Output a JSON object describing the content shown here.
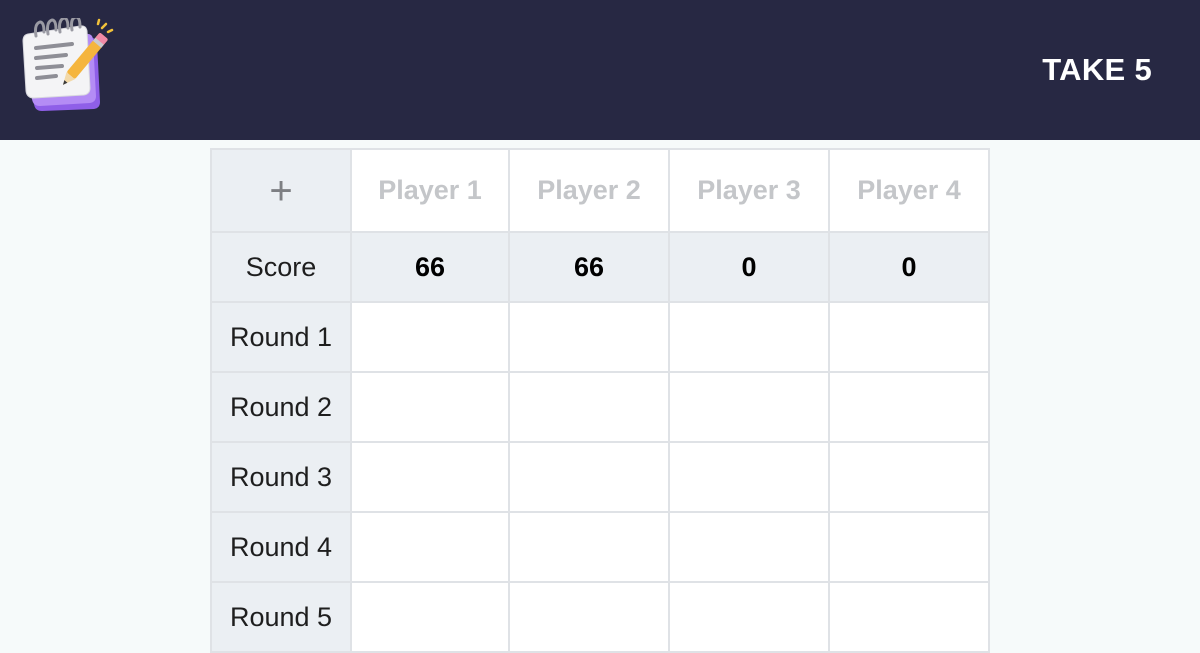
{
  "header": {
    "title": "TAKE 5",
    "logo_icon": "notepad-pencil-icon"
  },
  "table": {
    "add_player_label": "+",
    "players": [
      "Player 1",
      "Player 2",
      "Player 3",
      "Player 4"
    ],
    "score_label": "Score",
    "scores": [
      "66",
      "66",
      "0",
      "0"
    ],
    "rounds": [
      {
        "label": "Round 1",
        "values": [
          "",
          "",
          "",
          ""
        ]
      },
      {
        "label": "Round 2",
        "values": [
          "",
          "",
          "",
          ""
        ]
      },
      {
        "label": "Round 3",
        "values": [
          "",
          "",
          "",
          ""
        ]
      },
      {
        "label": "Round 4",
        "values": [
          "",
          "",
          "",
          ""
        ]
      },
      {
        "label": "Round 5",
        "values": [
          "",
          "",
          "",
          ""
        ]
      }
    ]
  },
  "colors": {
    "header_bg": "#272843",
    "page_bg": "#f6fafa",
    "label_bg": "#ebeff3",
    "placeholder_text": "#c4c6c9",
    "logo_purple": "#9b6cf0"
  }
}
